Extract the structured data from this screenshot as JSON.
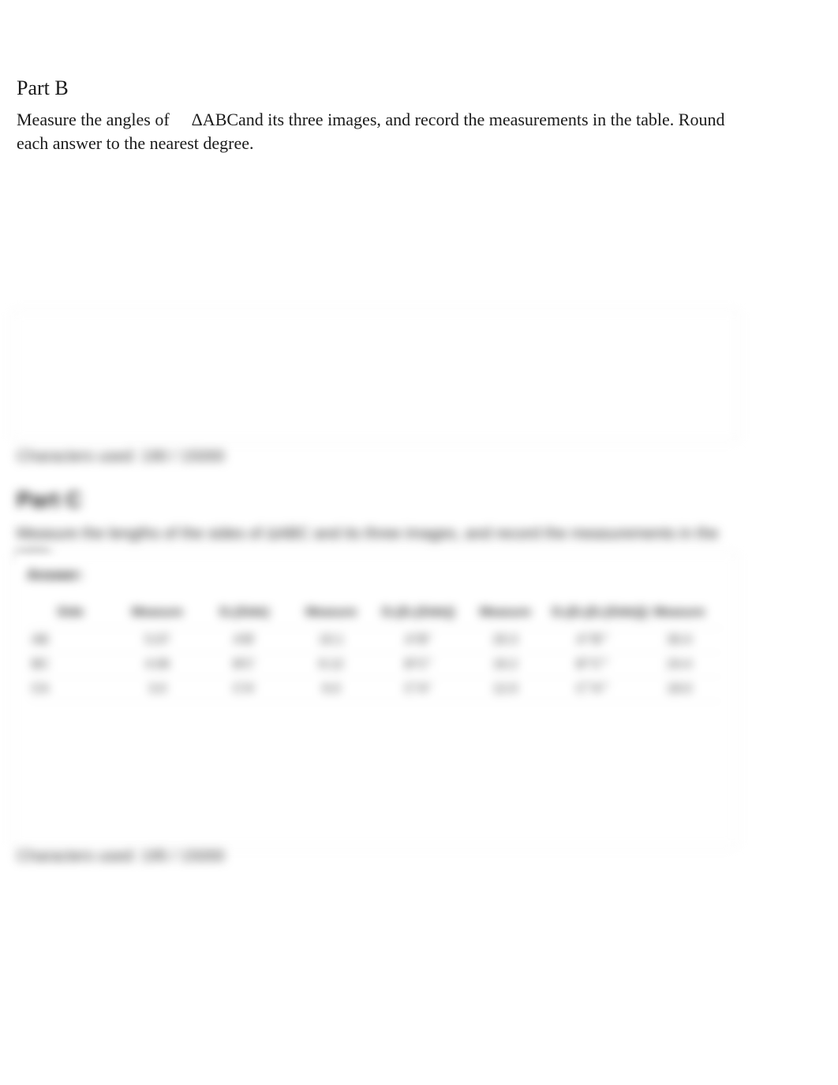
{
  "partB": {
    "heading": "Part B",
    "text_pre": "Measure the angles of",
    "triangle": "ΔABC",
    "text_post": "and its three images, and record the measurements in the table. Round each answer to the nearest degree."
  },
  "charCountB": "Characters used: 190 / 15000",
  "partC": {
    "heading": "Part C",
    "text": "Measure the lengths of the sides of ΔABC and its three images, and record the measurements in the table."
  },
  "panelC": {
    "answer_label": "Answer:",
    "headers": [
      "Side",
      "Measure",
      "D₁(Side)",
      "Measure",
      "D₂(D₁(Side))",
      "Measure",
      "D₃(D₂(D₁(Side)))",
      "Measure"
    ],
    "rows": [
      [
        "AB",
        "5.07",
        "A'B'",
        "10.1",
        "A''B''",
        "20.3",
        "A'''B'''",
        "30.4"
      ],
      [
        "BC",
        "4.06",
        "B'C'",
        "8.12",
        "B''C''",
        "16.2",
        "B'''C'''",
        "24.4"
      ],
      [
        "CA",
        "3.0",
        "C'A'",
        "6.0",
        "C''A''",
        "12.0",
        "C'''A'''",
        "18.0"
      ]
    ]
  },
  "charCountC": "Characters used: 195 / 15000"
}
